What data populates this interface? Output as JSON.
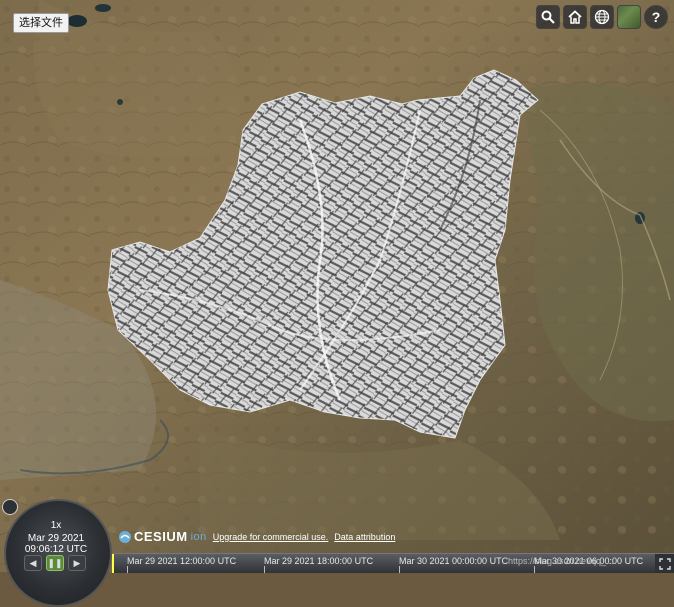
{
  "file_button": {
    "label": "选择文件"
  },
  "toolbar": {
    "search_icon": "search-icon",
    "home_icon": "home-icon",
    "globe_icon": "globe-icon",
    "imagery_icon": "imagery-icon",
    "help_label": "?"
  },
  "animation": {
    "speed": "1x",
    "date": "Mar 29 2021",
    "time": "09:06:12 UTC"
  },
  "credits": {
    "logo_text": "CESIUM",
    "logo_suffix": "ion",
    "upgrade_link": "Upgrade for commercial use.",
    "data_attribution": "Data attribution"
  },
  "timeline": {
    "labels": [
      "Mar 29 2021 12:00:00 UTC",
      "Mar 29 2021 18:00:00 UTC",
      "Mar 30 2021 00:00:00 UTC",
      "Mar 30 2021 06:00:00 UTC"
    ]
  },
  "watermark": "https://blog.csdn.net/qq_..."
}
